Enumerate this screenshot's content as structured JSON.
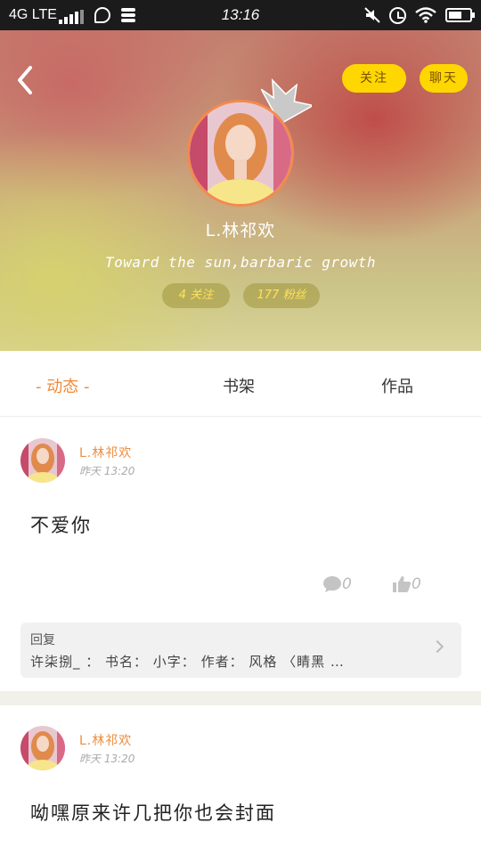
{
  "status_bar": {
    "network": "4G LTE",
    "time": "13:16"
  },
  "header": {
    "follow_label": "关注",
    "chat_label": "聊天",
    "user_name": "L.林祁欢",
    "bio": "Toward the sun,barbaric growth",
    "following": "4 关注",
    "fans": "177 粉丝"
  },
  "tabs": [
    {
      "label": "- 动态 -",
      "active": true
    },
    {
      "label": "书架",
      "active": false
    },
    {
      "label": "作品",
      "active": false
    }
  ],
  "posts": [
    {
      "author": "L.林祁欢",
      "time": "昨天 13:20",
      "text": "不爱你",
      "comments": "0",
      "likes": "0",
      "reply_label": "回复",
      "reply_text": "许柒捌_ ： 书名： 小字： 作者： 风格 〈睛黑 …"
    },
    {
      "author": "L.林祁欢",
      "time": "昨天 13:20",
      "text": "呦嘿原来许几把你也会封面"
    }
  ],
  "colors": {
    "accent": "#ee8d3f",
    "button_yellow": "#ffd700",
    "avatar_border": "#f38a4d"
  },
  "icons": [
    "back-arrow-icon",
    "crown-icon",
    "comment-icon",
    "thumbs-up-icon",
    "chevron-right-icon"
  ]
}
